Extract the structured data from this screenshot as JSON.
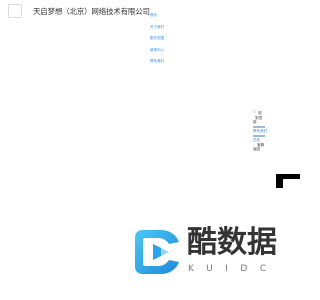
{
  "header": {
    "company_name": "天启梦想（北京）网络技术有限公司"
  },
  "nav": {
    "items": [
      {
        "label": "首页"
      },
      {
        "label": "关于我们"
      },
      {
        "label": "服务范围"
      },
      {
        "label": "新闻中心"
      },
      {
        "label": "联系我们"
      }
    ]
  },
  "side_panel": {
    "line1": "回",
    "line2": "到顶",
    "line3": "部",
    "link1": "联系我们",
    "link2": "在线",
    "line4": "客服",
    "line5": "返回"
  },
  "brand": {
    "name": "酷数据",
    "sub": "KUIDC",
    "colors": {
      "accent": "#3db6f2",
      "accent_dark": "#1e88d8",
      "text": "#333333"
    }
  }
}
